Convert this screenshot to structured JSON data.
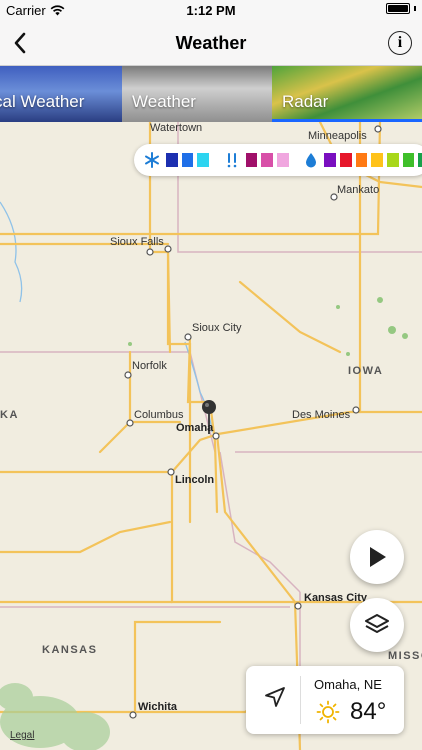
{
  "status_bar": {
    "carrier": "Carrier",
    "time": "1:12 PM",
    "battery_level": 1.0
  },
  "nav": {
    "title": "Weather",
    "back_icon": "chevron-left-icon",
    "info_icon": "info-icon",
    "info_glyph": "i"
  },
  "tabs": [
    {
      "label": "cal Weather",
      "active": false
    },
    {
      "label": "Weather",
      "active": false
    },
    {
      "label": "Radar",
      "active": true
    }
  ],
  "legend": {
    "snow_colors": [
      "#1c2fb0",
      "#1f6fe8",
      "#2dd4f0"
    ],
    "mix_colors": [
      "#a0106a",
      "#d84fa8",
      "#f0a6df"
    ],
    "rain_colors": [
      "#7a0ec0",
      "#e6162a",
      "#ff7a14",
      "#ffc21a",
      "#a8d71a",
      "#3fbf2a",
      "#19a14a"
    ]
  },
  "map": {
    "cities": [
      {
        "name": "Watertown",
        "bold": false
      },
      {
        "name": "Minneapolis",
        "bold": false
      },
      {
        "name": "Mankato",
        "bold": false
      },
      {
        "name": "Sioux Falls",
        "bold": false
      },
      {
        "name": "Sioux City",
        "bold": false
      },
      {
        "name": "Norfolk",
        "bold": false
      },
      {
        "name": "Columbus",
        "bold": false
      },
      {
        "name": "Omaha",
        "bold": true
      },
      {
        "name": "Des Moines",
        "bold": false
      },
      {
        "name": "Lincoln",
        "bold": true
      },
      {
        "name": "Kansas City",
        "bold": true
      },
      {
        "name": "Wichita",
        "bold": true
      }
    ],
    "states": [
      "IOWA",
      "KA",
      "KANSAS",
      "MISSO"
    ],
    "legal": "Legal"
  },
  "controls": {
    "play_icon": "play-icon",
    "layers_icon": "layers-icon"
  },
  "location": {
    "name": "Omaha, NE",
    "temp": "84°",
    "condition_icon": "sun-icon",
    "locate_icon": "location-arrow-icon"
  }
}
